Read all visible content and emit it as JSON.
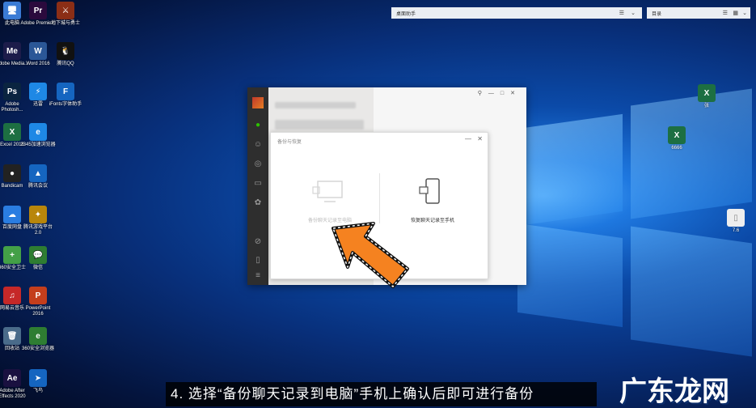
{
  "desktop_icons": [
    {
      "label": "此电脑",
      "glyph": "🖥",
      "color": "#3a7bd5"
    },
    {
      "label": "Adobe Premie...",
      "glyph": "Pr",
      "color": "#2b0a3d"
    },
    {
      "label": "地下城与勇士",
      "glyph": "⚔",
      "color": "#8b2e16"
    },
    {
      "label": "Adobe Media...",
      "glyph": "Me",
      "color": "#1c1c4a"
    },
    {
      "label": "Word 2016",
      "glyph": "W",
      "color": "#2b5797"
    },
    {
      "label": "腾讯QQ",
      "glyph": "🐧",
      "color": "#111"
    },
    {
      "label": "Adobe Photosh...",
      "glyph": "Ps",
      "color": "#0a2440"
    },
    {
      "label": "迅雷",
      "glyph": "⚡",
      "color": "#1e88e5"
    },
    {
      "label": "iFonts字体助手",
      "glyph": "F",
      "color": "#1565c0"
    },
    {
      "label": "Excel 2016",
      "glyph": "X",
      "color": "#1d6f42"
    },
    {
      "label": "2345加速浏览器",
      "glyph": "e",
      "color": "#1e88e5"
    },
    {
      "label": "Bandicam",
      "glyph": "●",
      "color": "#222"
    },
    {
      "label": "腾讯会议",
      "glyph": "▲",
      "color": "#1565c0"
    },
    {
      "label": "百度网盘",
      "glyph": "☁",
      "color": "#2a7de1"
    },
    {
      "label": "腾讯游戏平台 2.0",
      "glyph": "✦",
      "color": "#b8860b"
    },
    {
      "label": "360安全卫士",
      "glyph": "+",
      "color": "#43a047"
    },
    {
      "label": "微信",
      "glyph": "💬",
      "color": "#2e7d32"
    },
    {
      "label": "网易云音乐",
      "glyph": "♫",
      "color": "#c62828"
    },
    {
      "label": "PowerPoint 2016",
      "glyph": "P",
      "color": "#c43e1c"
    },
    {
      "label": "回收站",
      "glyph": "🗑",
      "color": "#4a6b8a"
    },
    {
      "label": "360安全浏览器",
      "glyph": "e",
      "color": "#2e7d32"
    },
    {
      "label": "Adobe After Effects 2020",
      "glyph": "Ae",
      "color": "#1a1140"
    },
    {
      "label": "飞鸟",
      "glyph": "➤",
      "color": "#1565c0"
    }
  ],
  "right_icons": [
    {
      "label": "张",
      "glyph": "X",
      "color": "#1d6f42"
    },
    {
      "label": "6666",
      "glyph": "X",
      "color": "#1d6f42"
    },
    {
      "label": "7.6",
      "glyph": "▯",
      "color": "#eeeeee"
    }
  ],
  "top_boxes": {
    "left_text": "桌面助手",
    "right_text": "目录"
  },
  "dialog": {
    "title": "备份与恢复",
    "option_pc": "备份聊天记录至电脑",
    "option_phone": "恢复聊天记录至手机",
    "close": "✕",
    "minimize": "—"
  },
  "caption": "4. 选择“备份聊天记录到电脑”手机上确认后即可进行备份",
  "watermark": "广东龙网"
}
